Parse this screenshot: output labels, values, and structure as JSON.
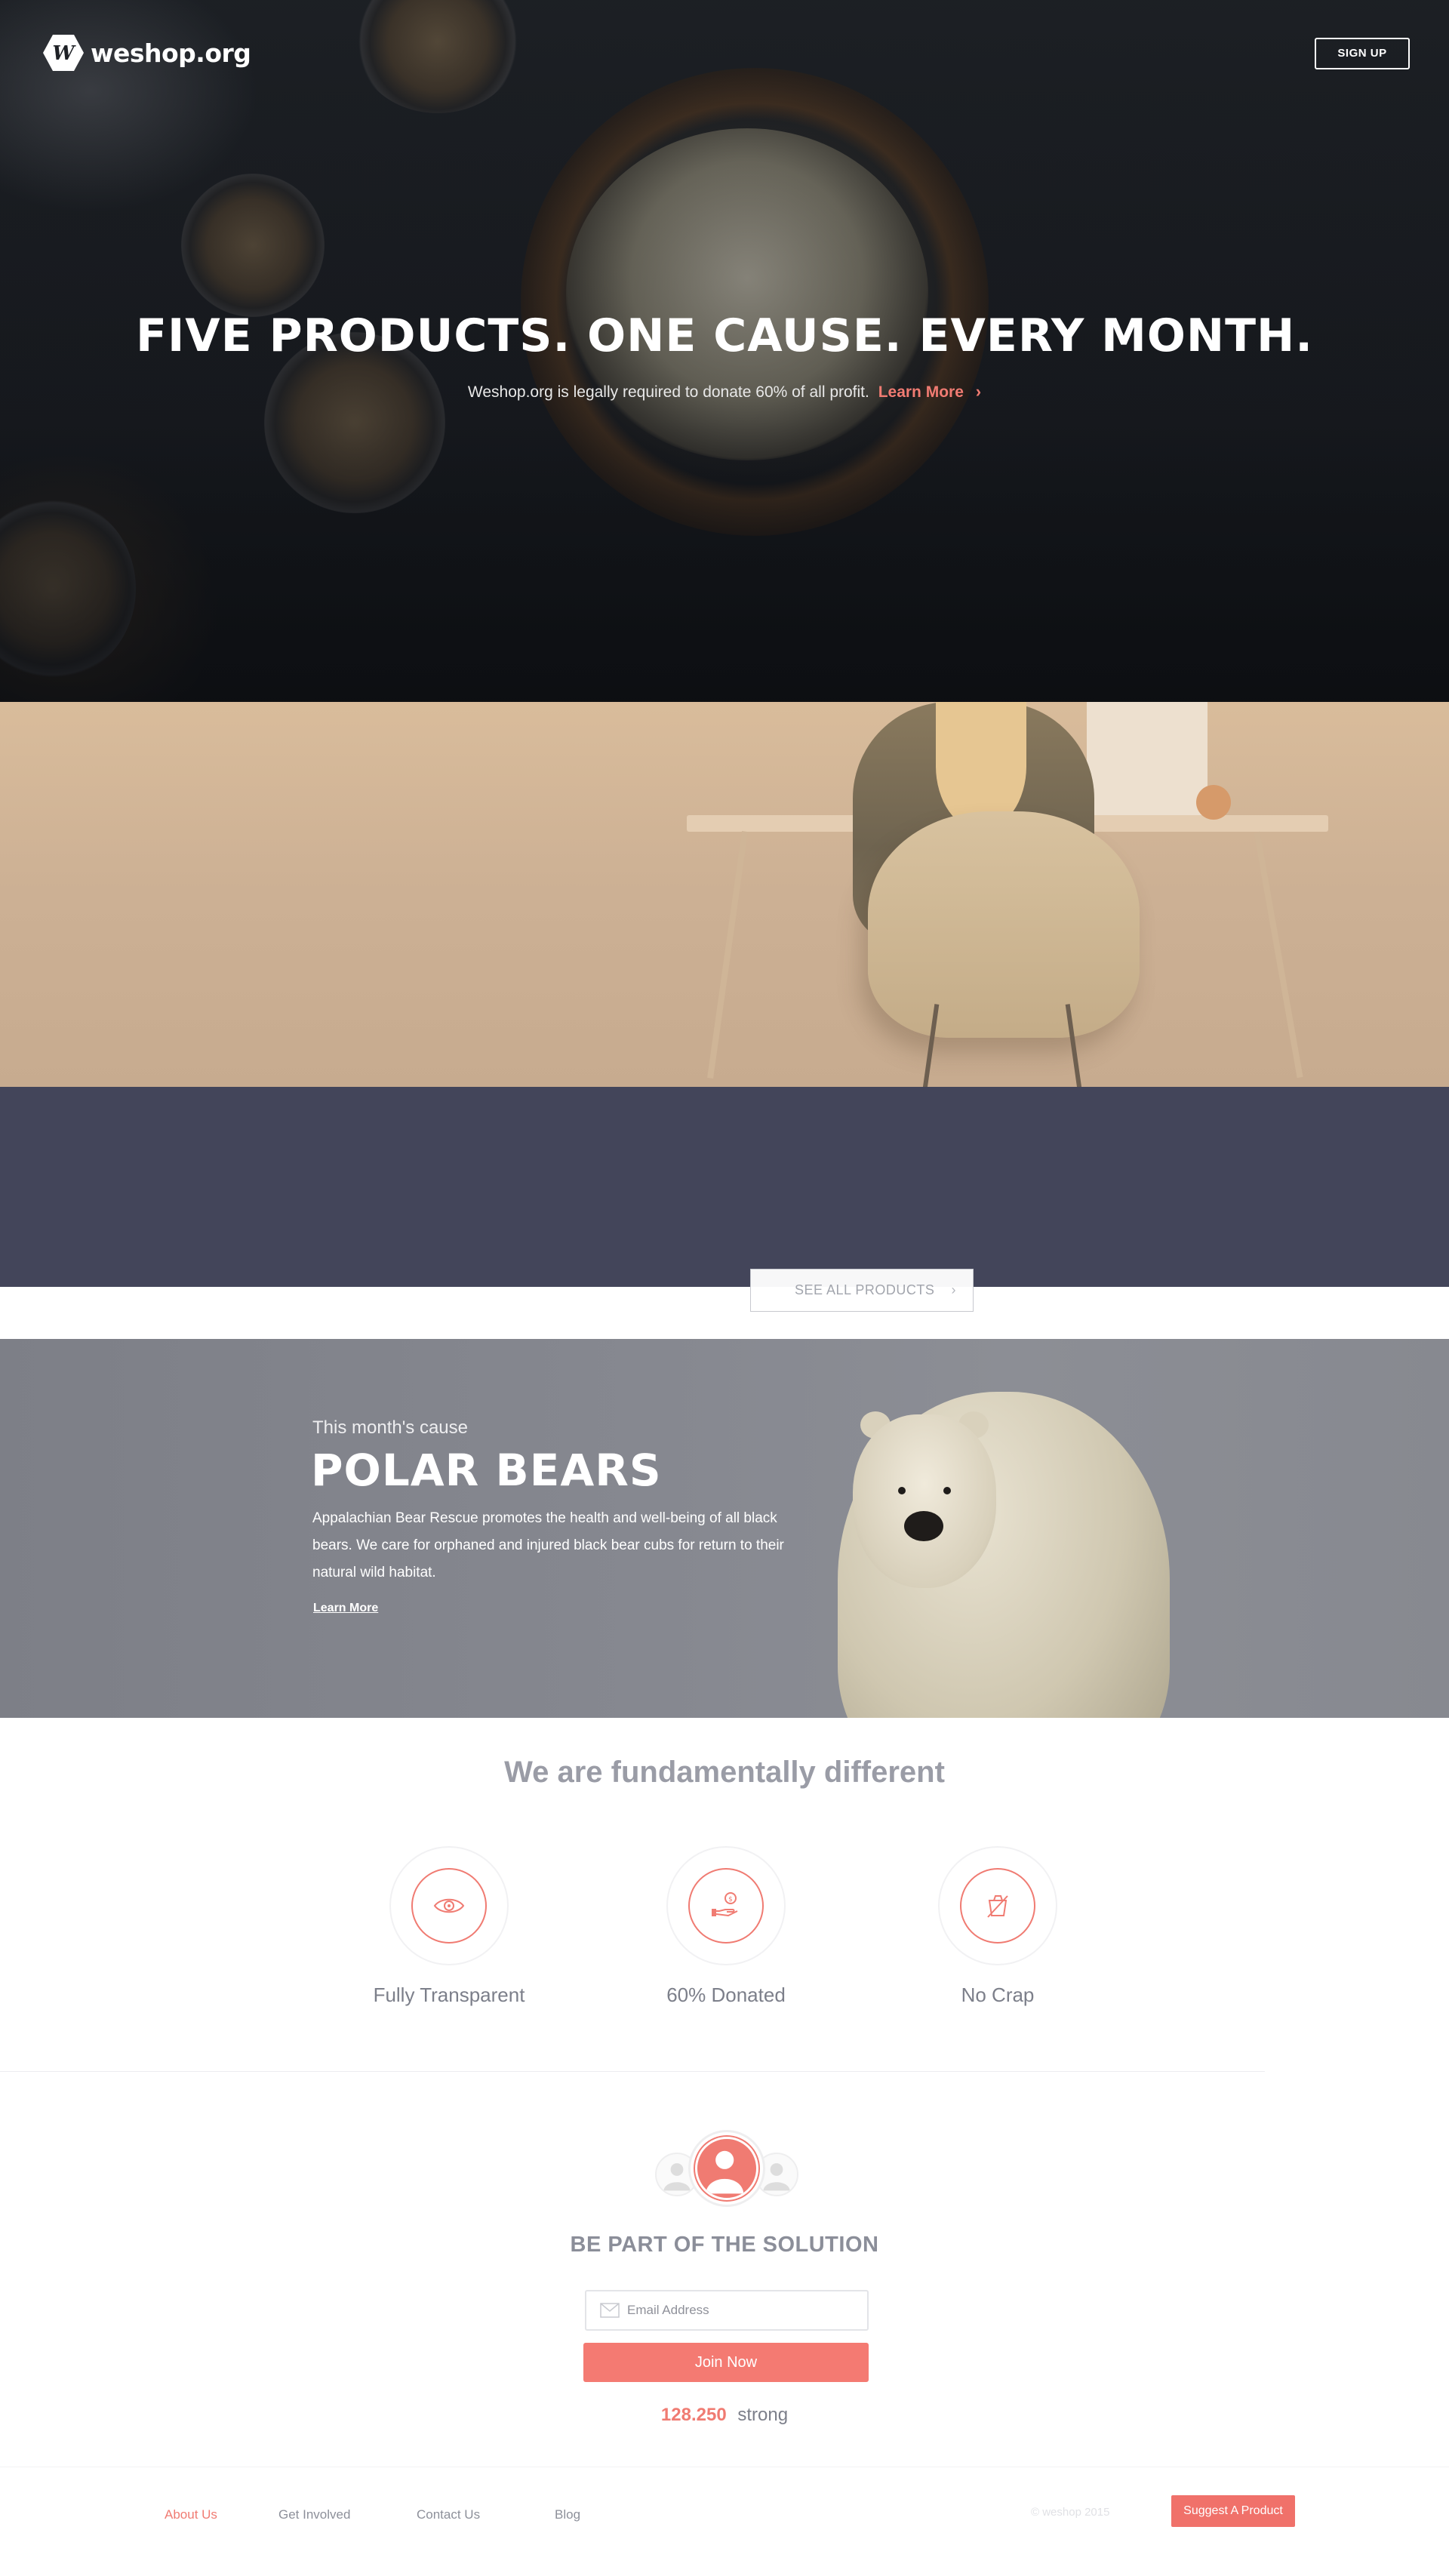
{
  "header": {
    "logo_text": "weshop.org",
    "signup_label": "SIGN UP"
  },
  "hero": {
    "title": "FIVE PRODUCTS. ONE CAUSE. EVERY MONTH.",
    "subtitle": "Weshop.org is legally required to donate 60% of all profit.",
    "learn_more": "Learn More",
    "chevron": "›"
  },
  "products": {
    "see_all_label": "SEE ALL PRODUCTS",
    "arrow": "›"
  },
  "cause": {
    "kicker": "This month's cause",
    "title": "POLAR BEARS",
    "text": "Appalachian Bear Rescue promotes the health and well-being of all black bears. We care for orphaned and injured black bear cubs for return to their natural wild habitat.",
    "link": "Learn More"
  },
  "features": {
    "title": "We are fundamentally different",
    "items": [
      {
        "label": "Fully Transparent",
        "icon": "eye-icon"
      },
      {
        "label": "60% Donated",
        "icon": "hand-coin-icon"
      },
      {
        "label": "No Crap",
        "icon": "no-trash-icon"
      }
    ]
  },
  "cta": {
    "title": "BE PART OF THE SOLUTION",
    "email_placeholder": "Email Address",
    "join_label": "Join Now",
    "count_number": "128.250",
    "count_word": "strong"
  },
  "footer": {
    "links": [
      "About Us",
      "Get Involved",
      "Contact Us",
      "Blog"
    ],
    "copyright": "© weshop 2015",
    "suggest_label": "Suggest A Product"
  },
  "colors": {
    "accent": "#f07b72",
    "dark_band": "#43455a",
    "muted_text": "#8b8e99"
  }
}
